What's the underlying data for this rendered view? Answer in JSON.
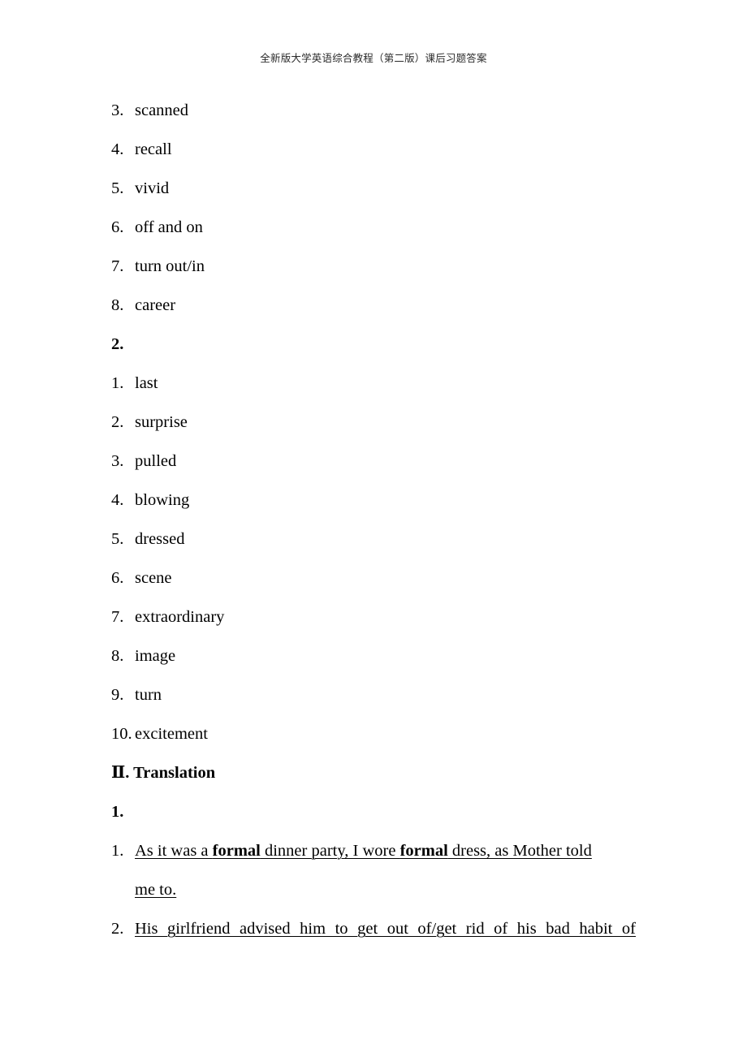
{
  "header": {
    "running_title": "全新版大学英语综合教程（第二版）课后习题答案"
  },
  "vocabulary_continued": {
    "items": [
      {
        "marker": "3.",
        "text": "scanned"
      },
      {
        "marker": "4.",
        "text": "recall"
      },
      {
        "marker": "5.",
        "text": "vivid"
      },
      {
        "marker": "6.",
        "text": "off and on"
      },
      {
        "marker": "7.",
        "text": "turn out/in"
      },
      {
        "marker": "8.",
        "text": "career"
      }
    ]
  },
  "section_two": {
    "heading": "2.",
    "items": [
      {
        "marker": "1.",
        "text": "last"
      },
      {
        "marker": "2.",
        "text": "surprise"
      },
      {
        "marker": "3.",
        "text": "pulled"
      },
      {
        "marker": "4.",
        "text": "blowing"
      },
      {
        "marker": "5.",
        "text": "dressed"
      },
      {
        "marker": "6.",
        "text": "scene"
      },
      {
        "marker": "7.",
        "text": "extraordinary"
      },
      {
        "marker": "8.",
        "text": "image"
      },
      {
        "marker": "9.",
        "text": "turn"
      },
      {
        "marker": "10.",
        "text": "excitement"
      }
    ]
  },
  "translation": {
    "roman_numeral": "Ⅱ",
    "heading": "Ⅱ. Translation",
    "subheading": "1.",
    "sentences": [
      {
        "marker": "1.",
        "line1_prefix": "As it was a ",
        "bold1": "formal",
        "line1_middle": " dinner party, I wore ",
        "bold2": "formal",
        "line1_suffix": " dress, as Mother told",
        "line2": "me to.",
        "full_text": "As it was a formal dinner party, I wore formal dress, as Mother told me to."
      },
      {
        "marker": "2.",
        "line1": "His girlfriend advised him to get out of/get rid of his bad habit of",
        "full_text": "His girlfriend advised him to get out of/get rid of his bad habit of"
      }
    ]
  }
}
